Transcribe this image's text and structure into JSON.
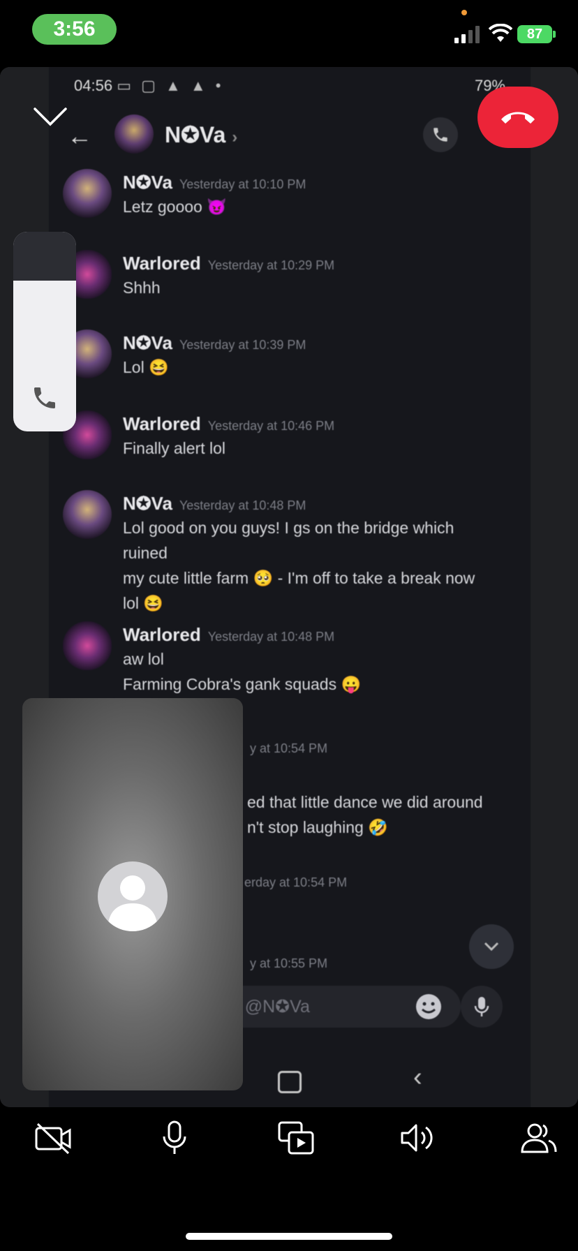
{
  "status_bar": {
    "time": "3:56",
    "battery": "87"
  },
  "shared_screen": {
    "android_status": {
      "time": "04:56",
      "icons": "▭ ▢ ▲ ▲ •",
      "battery": "79%"
    },
    "chat_header": {
      "name": "N✪Va",
      "chevron": "›"
    },
    "messages": [
      {
        "author": "N✪Va",
        "time": "Yesterday at 10:10 PM",
        "lines": [
          "Letz goooo 😈"
        ],
        "avatar": "nova"
      },
      {
        "author": "Warlored",
        "time": "Yesterday at 10:29 PM",
        "lines": [
          "Shhh"
        ],
        "avatar": "warlored"
      },
      {
        "author": "N✪Va",
        "time": "Yesterday at 10:39 PM",
        "lines": [
          "Lol 😆"
        ],
        "avatar": "nova"
      },
      {
        "author": "Warlored",
        "time": "Yesterday at 10:46 PM",
        "lines": [
          "Finally alert lol"
        ],
        "avatar": "warlored"
      },
      {
        "author": "N✪Va",
        "time": "Yesterday at 10:48 PM",
        "lines": [
          "Lol good on you guys! I gs on the bridge which ruined",
          "my cute little farm 🥺 - I'm off to take a break now",
          "lol 😆"
        ],
        "avatar": "nova"
      },
      {
        "author": "Warlored",
        "time": "Yesterday at 10:48 PM",
        "lines": [
          "aw lol",
          "Farming Cobra's gank squads 😛"
        ],
        "avatar": "warlored"
      }
    ],
    "partial_rows": {
      "time_1": "y at 10:54 PM",
      "line_1": "ed that little dance we did around",
      "line_2": "n't stop laughing 🤣",
      "time_2": "erday at 10:54 PM",
      "time_3": "y at 10:55 PM"
    },
    "composer_placeholder": "ge @N✪Va"
  },
  "controls": {
    "video": "camera-off-icon",
    "mic": "microphone-icon",
    "share": "screen-share-icon",
    "speaker": "speaker-icon",
    "participants": "participants-icon"
  },
  "colors": {
    "end_call": "#ec2438",
    "call_pill": "#5ac05a",
    "battery": "#4cd964"
  }
}
